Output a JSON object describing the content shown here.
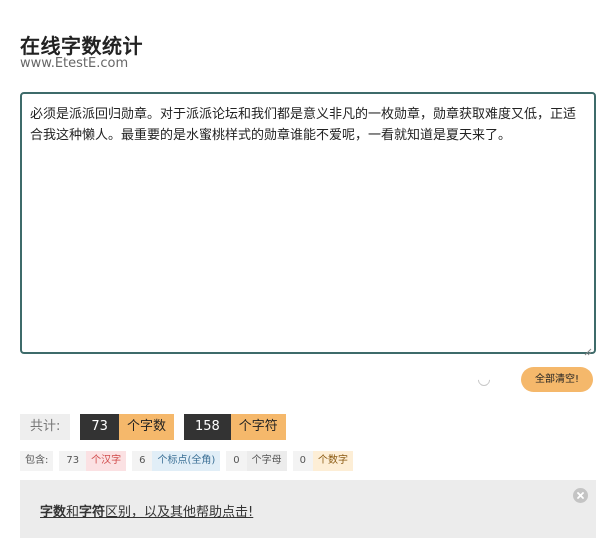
{
  "header": {
    "title": "在线字数统计",
    "subtitle": "www.EtestE.com"
  },
  "editor": {
    "text": "必须是派派回归勋章。对于派派论坛和我们都是意义非凡的一枚勋章，勋章获取难度又低，正适合我这种懒人。最重要的是水蜜桃样式的勋章谁能不爱呢，一看就知道是夏天来了。"
  },
  "actions": {
    "clear_all": "全部清空!"
  },
  "totals": {
    "label": "共计:",
    "word_count": "73",
    "word_unit": "个字数",
    "char_count": "158",
    "char_unit": "个字符"
  },
  "details": {
    "label": "包含:",
    "chinese_count": "73",
    "chinese_unit": "个汉字",
    "punct_count": "6",
    "punct_unit": "个标点(全角)",
    "letter_count": "0",
    "letter_unit": "个字母",
    "digit_count": "0",
    "digit_unit": "个数字"
  },
  "help": {
    "bold1": "字数",
    "and": "和",
    "bold2": "字符",
    "rest": "区别，以及其他帮助点击!"
  },
  "icons": {
    "close": "close-icon",
    "loading": "loading-spinner-icon",
    "resize": "resize-grip-icon"
  },
  "colors": {
    "accent_orange": "#f5b86b",
    "dark": "#333333",
    "textarea_border": "#3e6b6a"
  }
}
